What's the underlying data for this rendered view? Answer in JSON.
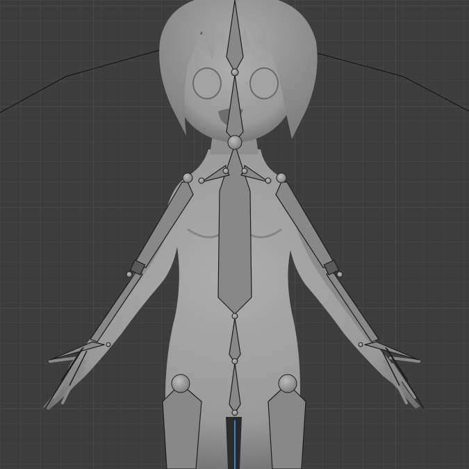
{
  "viewport": {
    "background": "#3d3d3d",
    "grid_color": "#474747",
    "mesh_color": "#9c9c9c",
    "mesh_shadow": "#5e5e5e",
    "bone_fill": "#878787",
    "bone_stroke": "#1c1c1c",
    "joint_fill": "#9a9a9a",
    "axis_color": "#3f7fd9"
  },
  "icons": {
    "mesh": "character-mesh",
    "armature": "armature-bones"
  }
}
